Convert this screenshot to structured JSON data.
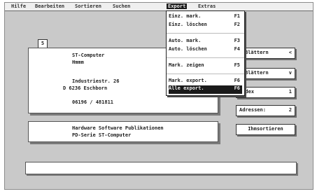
{
  "menubar": {
    "items": [
      "Hilfe",
      "Bearbeiten",
      "Sortieren",
      "Suchen",
      "Export",
      "Extras"
    ]
  },
  "export_menu": {
    "items": [
      {
        "label": "Einz. mark.",
        "key": "F1"
      },
      {
        "label": "Einz. löschen",
        "key": "F2"
      },
      {
        "label": "Auto. mark.",
        "key": "F3"
      },
      {
        "label": "Auto. löschen",
        "key": "F4"
      },
      {
        "label": "Mark. zeigen",
        "key": "F5"
      },
      {
        "label": "Mark. export.",
        "key": "F6"
      },
      {
        "label": "Alle export.",
        "key": "F6"
      }
    ]
  },
  "record": {
    "number": "5",
    "address_lines": [
      "ST-Computer",
      "Hmmm",
      "Industriestr. 26",
      "D  6236 Eschborn",
      "06196 / 481811"
    ],
    "subject_lines": [
      "Hardware Software Publikationen",
      "PD-Serie ST-Computer"
    ]
  },
  "side_buttons": {
    "forward": {
      "label": "Blättern",
      "symbol": "<"
    },
    "back": {
      "label": "Blättern",
      "symbol": "v"
    },
    "index": {
      "label": "Index",
      "value": "1"
    },
    "addresses": {
      "label": "Adressen:",
      "value": "2"
    },
    "sort": {
      "label": "Ihmsortieren"
    }
  },
  "status": {
    "text": ""
  }
}
